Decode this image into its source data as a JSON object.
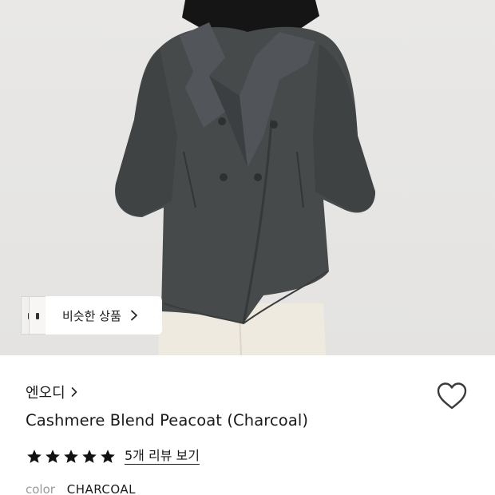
{
  "similar_items": {
    "label": "비슷한 상품"
  },
  "brand": {
    "name": "엔오디"
  },
  "product": {
    "title": "Cashmere Blend Peacoat (Charcoal)"
  },
  "rating": {
    "stars": 5,
    "max_stars": 5,
    "review_link": "5개 리뷰 보기"
  },
  "option": {
    "label": "color",
    "value": "CHARCOAL"
  },
  "icons": {
    "similar_chevron": "chevron-right-icon",
    "brand_chevron": "chevron-right-icon",
    "wishlist": "heart-outline-icon",
    "star": "star-icon"
  },
  "colors": {
    "coat": "#474a4b",
    "pants": "#ede8dd",
    "background": "#e7e6e4",
    "star": "#111111"
  }
}
